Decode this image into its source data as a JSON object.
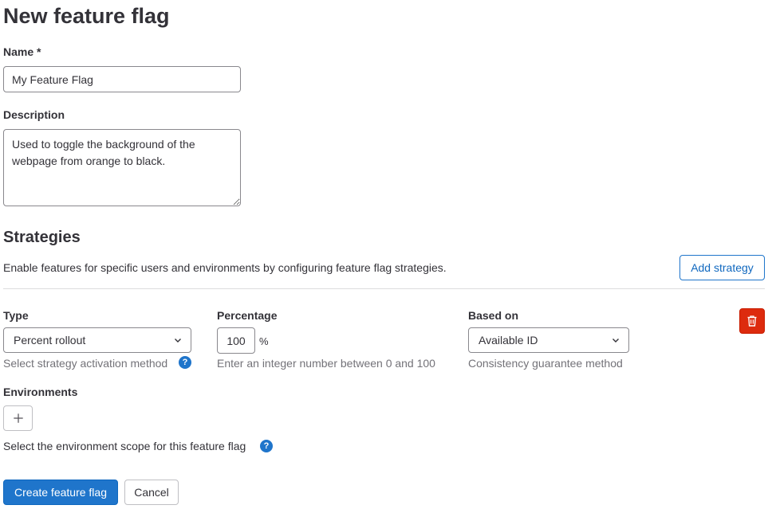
{
  "page": {
    "title": "New feature flag"
  },
  "name_field": {
    "label": "Name *",
    "value": "My Feature Flag"
  },
  "description_field": {
    "label": "Description",
    "value": "Used to toggle the background of the webpage from orange to black."
  },
  "strategies": {
    "title": "Strategies",
    "description": "Enable features for specific users and environments by configuring feature flag strategies.",
    "add_button": "Add strategy",
    "type": {
      "label": "Type",
      "selected": "Percent rollout",
      "help": "Select strategy activation method",
      "help_icon": "question-icon"
    },
    "percentage": {
      "label": "Percentage",
      "value": "100",
      "unit": "%",
      "help": "Enter an integer number between 0 and 100"
    },
    "based_on": {
      "label": "Based on",
      "selected": "Available ID",
      "help": "Consistency guarantee method"
    },
    "delete_icon": "trash-icon",
    "environments": {
      "label": "Environments",
      "add_icon": "plus-icon",
      "help": "Select the environment scope for this feature flag",
      "help_icon": "question-icon"
    }
  },
  "footer": {
    "create_button": "Create feature flag",
    "cancel_button": "Cancel"
  },
  "colors": {
    "primary": "#1f75cb",
    "danger": "#dd2b0e",
    "text": "#333238",
    "muted": "#737278"
  }
}
